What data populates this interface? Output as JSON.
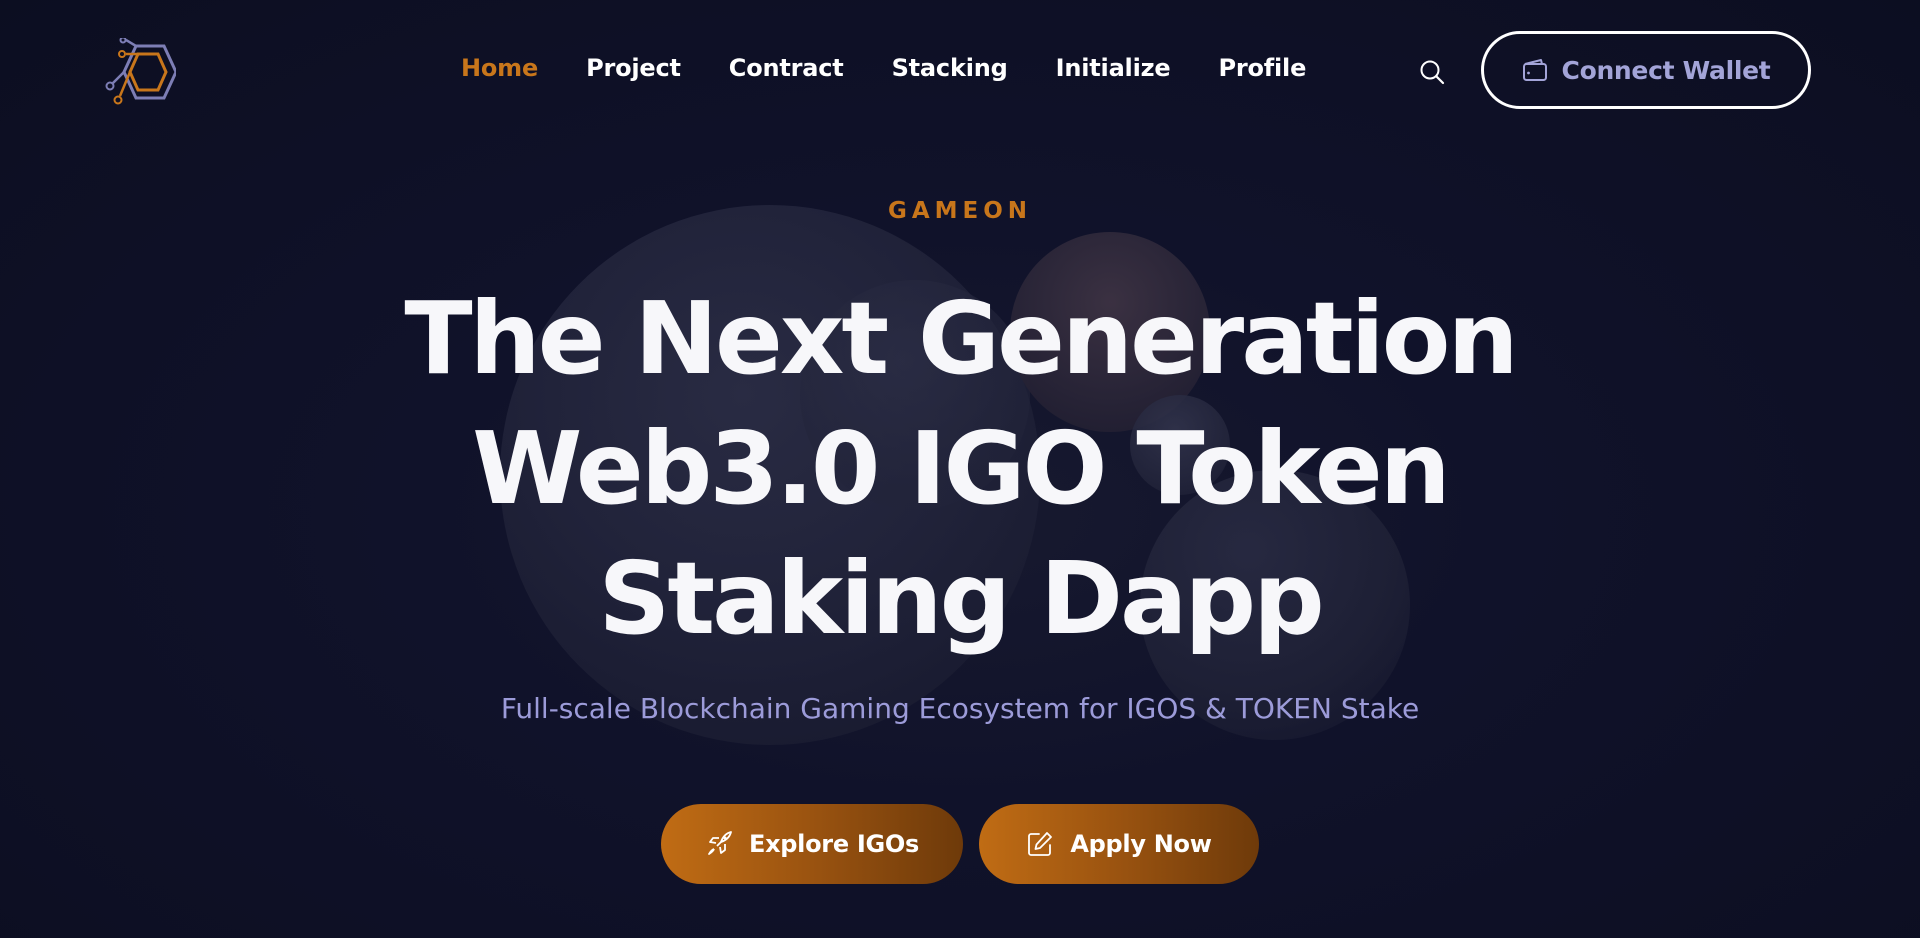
{
  "brand": {
    "logo_icon": "hexagon-circuit-logo-icon",
    "accent_color": "#c8761b",
    "secondary_color": "#9c9bd9"
  },
  "nav": {
    "items": [
      {
        "label": "Home",
        "active": true
      },
      {
        "label": "Project",
        "active": false
      },
      {
        "label": "Contract",
        "active": false
      },
      {
        "label": "Stacking",
        "active": false
      },
      {
        "label": "Initialize",
        "active": false
      },
      {
        "label": "Profile",
        "active": false
      }
    ],
    "search_icon": "search-icon",
    "connect_wallet_label": "Connect Wallet",
    "connect_wallet_icon": "wallet-icon"
  },
  "hero": {
    "eyebrow": "GAMEON",
    "headline_lines": [
      "The Next Generation",
      "Web3.0 IGO Token",
      "Staking Dapp"
    ],
    "subtitle": "Full-scale Blockchain Gaming Ecosystem for IGOS & TOKEN Stake",
    "buttons": [
      {
        "label": "Explore IGOs",
        "icon": "rocket-icon"
      },
      {
        "label": "Apply Now",
        "icon": "edit-icon"
      }
    ]
  }
}
